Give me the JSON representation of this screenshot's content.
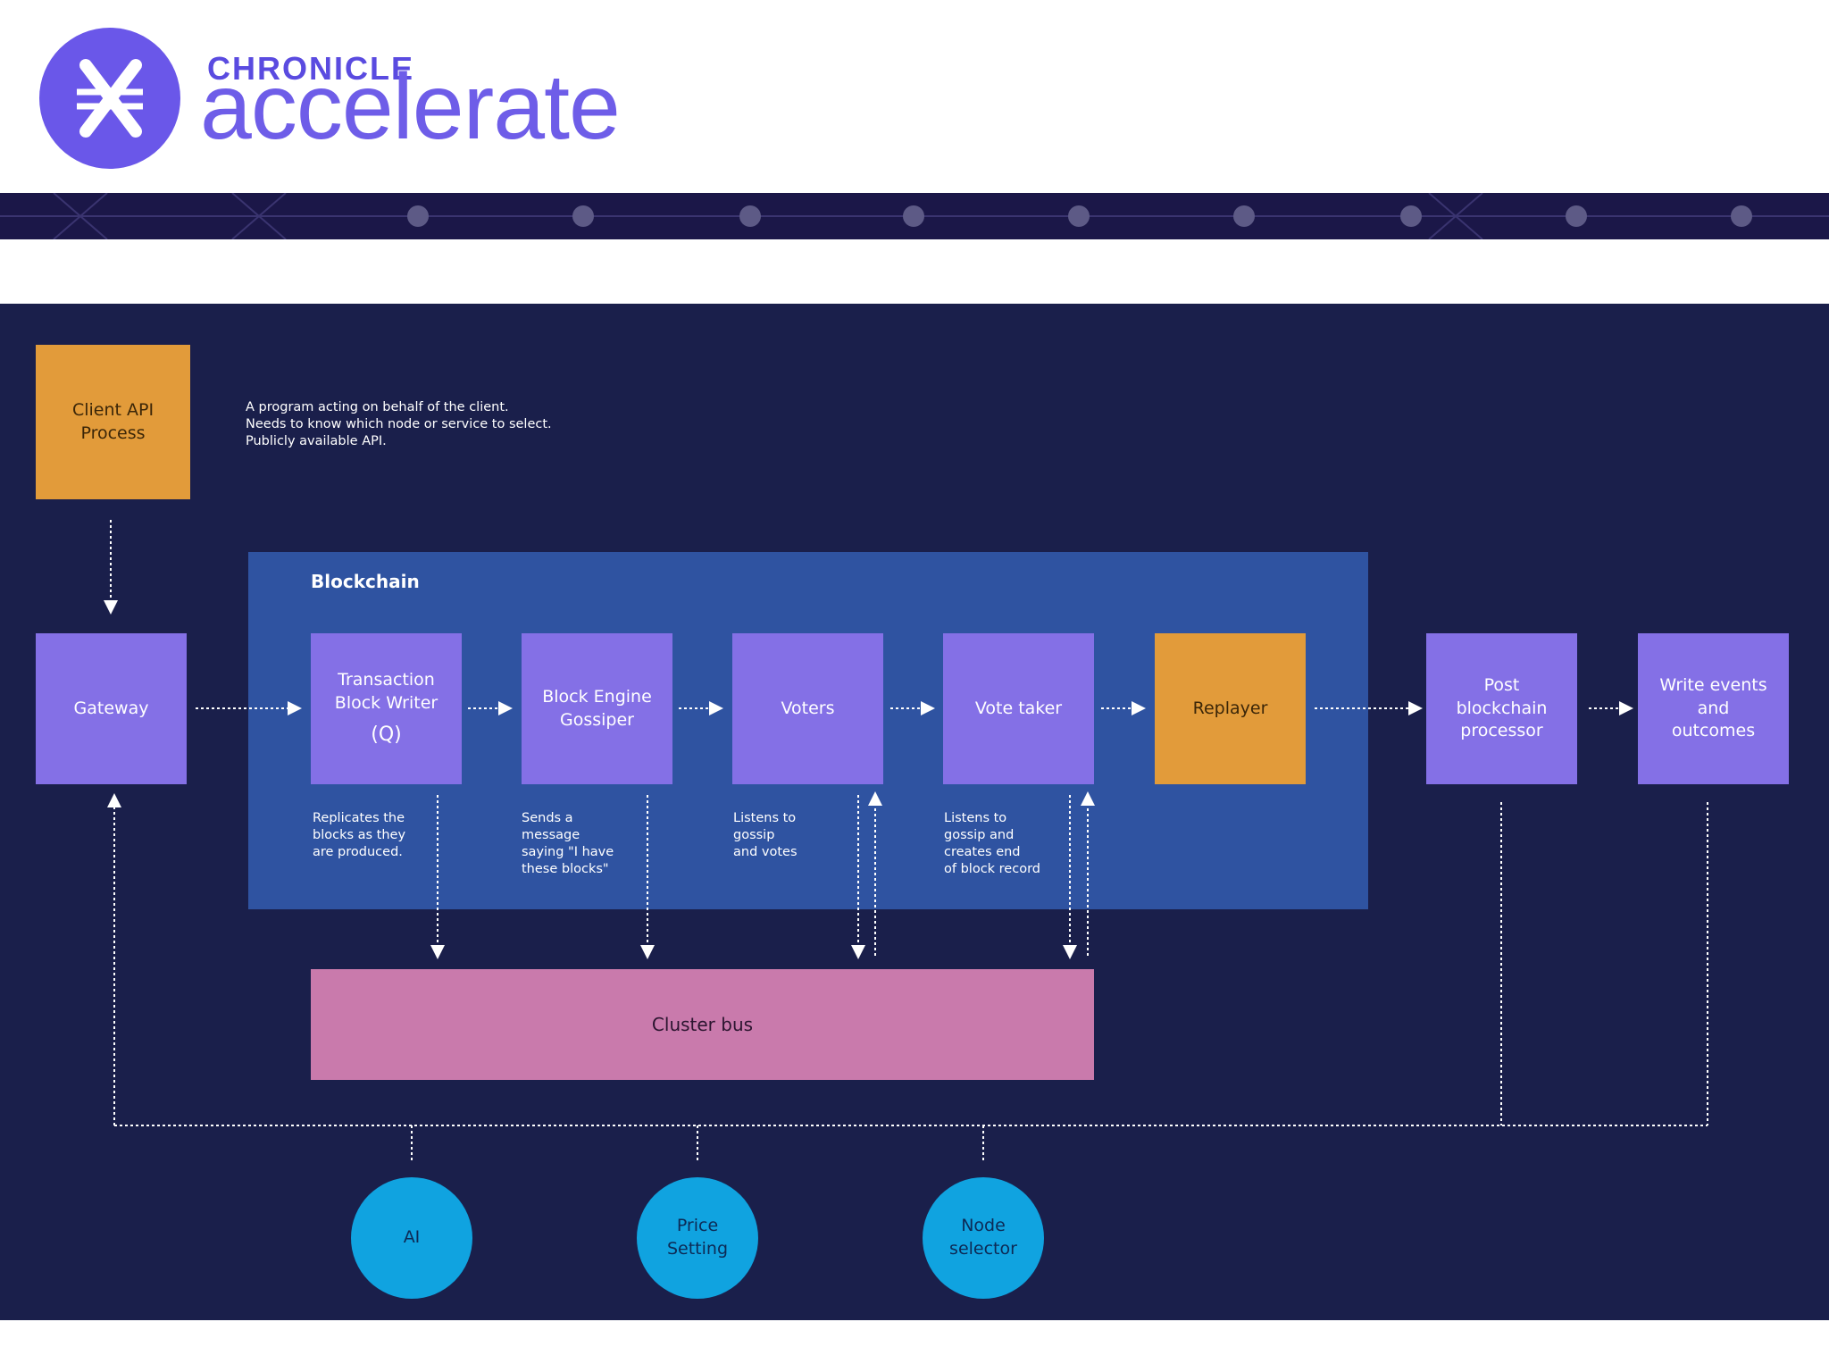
{
  "header": {
    "brand_small": "CHRONICLE",
    "brand_big": "accelerate",
    "colors": {
      "logo": "#6a57e9",
      "banner": "#1b1748"
    }
  },
  "diagram": {
    "background": "#1a1f4b",
    "nodes": {
      "client_api": "Client API\nProcess",
      "gateway": "Gateway",
      "transaction_block_writer": "Transaction\nBlock Writer",
      "transaction_block_writer_sub": "(Q)",
      "block_engine_gossiper": "Block Engine\nGossiper",
      "voters": "Voters",
      "vote_taker": "Vote taker",
      "replayer": "Replayer",
      "post_blockchain_processor": "Post\nblockchain\nprocessor",
      "write_events": "Write events\nand\noutcomes",
      "cluster_bus": "Cluster bus"
    },
    "regions": {
      "blockchain": "Blockchain"
    },
    "notes": {
      "client_api": "A program acting on behalf of the client.\nNeeds to know which node or service to select.\nPublicly available API.",
      "transaction_block_writer": "Replicates the\nblocks as they\nare produced.",
      "block_engine_gossiper": "Sends a\nmessage\nsaying \"I have\nthese blocks\"",
      "voters": "Listens to\ngossip\nand votes",
      "vote_taker": "Listens to\ngossip and\ncreates end\nof block record"
    },
    "services": {
      "ai": "AI",
      "price_setting": "Price\nSetting",
      "node_selector": "Node\nselector"
    },
    "colors": {
      "process": "#8470e6",
      "highlight": "#e29b3a",
      "bus": "#c97aac",
      "region": "#2f53a1",
      "service": "#10a3e0"
    }
  }
}
